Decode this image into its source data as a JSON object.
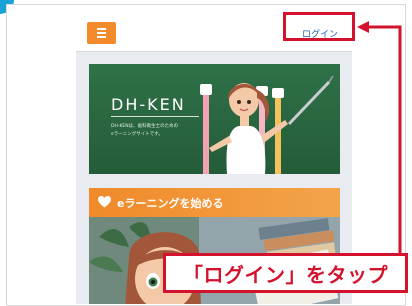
{
  "header": {
    "login_label": "ログイン"
  },
  "banner": {
    "title": "DH-KEN",
    "description": "DH-KENは、歯科衛生士のための\neラーニングサイトです。"
  },
  "elearning": {
    "label": "eラーニングを始める"
  },
  "annotation": {
    "caption": "「ログイン」をタップ"
  },
  "colors": {
    "accent_orange": "#f38b2c",
    "link_blue": "#1c60b8",
    "callout_red": "#d3132e",
    "banner_green": "#2f7148"
  },
  "icons": [
    "menu-icon",
    "heart-icon",
    "arrow-icon"
  ]
}
